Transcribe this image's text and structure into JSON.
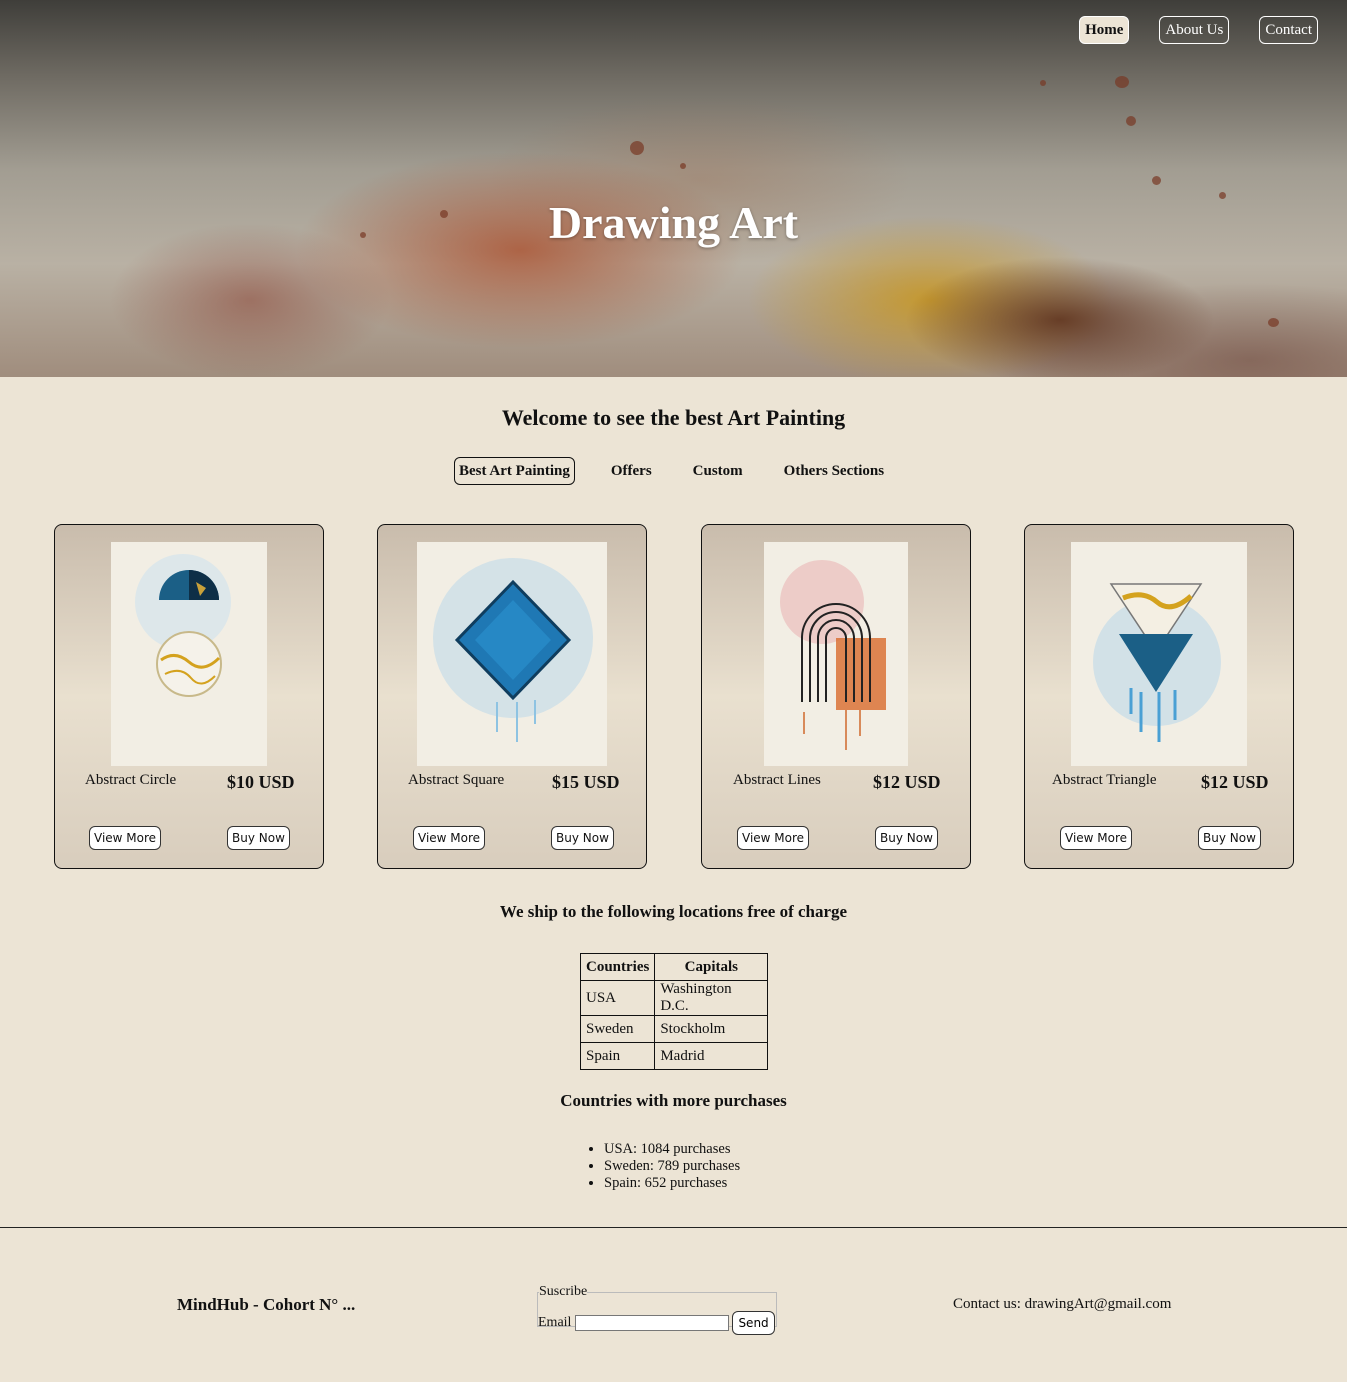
{
  "nav": {
    "items": [
      {
        "label": "Home",
        "active": true
      },
      {
        "label": "About Us",
        "active": false
      },
      {
        "label": "Contact",
        "active": false
      }
    ]
  },
  "hero": {
    "title": "Drawing Art"
  },
  "main": {
    "welcome": "Welcome to see the best Art Painting",
    "tabs": [
      {
        "label": "Best Art Painting",
        "active": true
      },
      {
        "label": "Offers",
        "active": false
      },
      {
        "label": "Custom",
        "active": false
      },
      {
        "label": "Others Sections",
        "active": false
      }
    ],
    "products": [
      {
        "name": "Abstract Circle",
        "price": "$10 USD",
        "view_label": "View More",
        "buy_label": "Buy Now",
        "art": "circle"
      },
      {
        "name": "Abstract Square",
        "price": "$15 USD",
        "view_label": "View More",
        "buy_label": "Buy Now",
        "art": "square"
      },
      {
        "name": "Abstract Lines",
        "price": "$12 USD",
        "view_label": "View More",
        "buy_label": "Buy Now",
        "art": "lines"
      },
      {
        "name": "Abstract Triangle",
        "price": "$12 USD",
        "view_label": "View More",
        "buy_label": "Buy Now",
        "art": "triangle"
      }
    ]
  },
  "shipping": {
    "title": "We ship to the following locations free of charge",
    "columns": [
      "Countries",
      "Capitals"
    ],
    "rows": [
      [
        "USA",
        "Washington D.C."
      ],
      [
        "Sweden",
        "Stockholm"
      ],
      [
        "Spain",
        "Madrid"
      ]
    ]
  },
  "purchases": {
    "title": "Countries with more purchases",
    "items": [
      "USA: 1084 purchases",
      "Sweden: 789 purchases",
      "Spain: 652 purchases"
    ]
  },
  "footer": {
    "brand": "MindHub - Cohort N° ...",
    "subscribe_legend": "Suscribe",
    "email_label": "Email",
    "email_value": "",
    "send_label": "Send",
    "contact": "Contact us: drawingArt@gmail.com"
  },
  "colors": {
    "page_bg": "#ece4d5",
    "text": "#111111",
    "blue_art": "#1f78b4",
    "gold_art": "#d4a21e"
  }
}
